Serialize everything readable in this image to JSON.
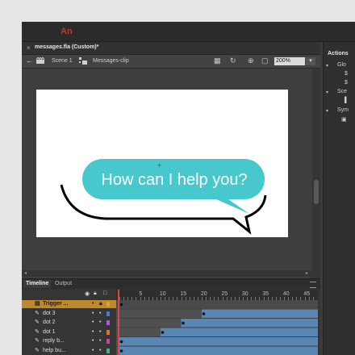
{
  "app": {
    "logo": "An"
  },
  "document": {
    "tab_title": "messages.fla (Custom)*",
    "close_glyph": "×"
  },
  "editbar": {
    "scene_label": "Scene 1",
    "clip_label": "Messages-clip",
    "zoom": "200%"
  },
  "stage": {
    "background": "#ffffff",
    "bubble_text": "How can I help you?",
    "bubble_color": "#46c8cc",
    "bubble_text_color": "#ffffff",
    "shadow_color": "#000000"
  },
  "right_panel": {
    "title": "Actions",
    "items": [
      "Glo",
      "Sce",
      "Sym"
    ]
  },
  "timeline": {
    "tabs": [
      "Timeline",
      "Output"
    ],
    "ruler": [
      "5",
      "10",
      "15",
      "20",
      "25",
      "30",
      "35",
      "40",
      "45"
    ],
    "layers": [
      {
        "name": "Trigger ...",
        "selected": true,
        "color": "#e0a030",
        "keyframe": 1,
        "tween_end": 1
      },
      {
        "name": "dot 3",
        "selected": false,
        "color": "#3a7bd5",
        "keyframe": 21,
        "tween_end": 50
      },
      {
        "name": "dot 2",
        "selected": false,
        "color": "#b05ad8",
        "keyframe": 16,
        "tween_end": 50
      },
      {
        "name": "dot 1",
        "selected": false,
        "color": "#e07030",
        "keyframe": 11,
        "tween_end": 50
      },
      {
        "name": "reply b...",
        "selected": false,
        "color": "#d040b0",
        "keyframe": 1,
        "tween_end": 50
      },
      {
        "name": "help bu...",
        "selected": false,
        "color": "#40b080",
        "keyframe": 1,
        "tween_end": 50
      }
    ],
    "accent": {
      "tween": "#5a86b4",
      "playhead": "#e04545",
      "selected_row": "#bf8a2c"
    }
  }
}
